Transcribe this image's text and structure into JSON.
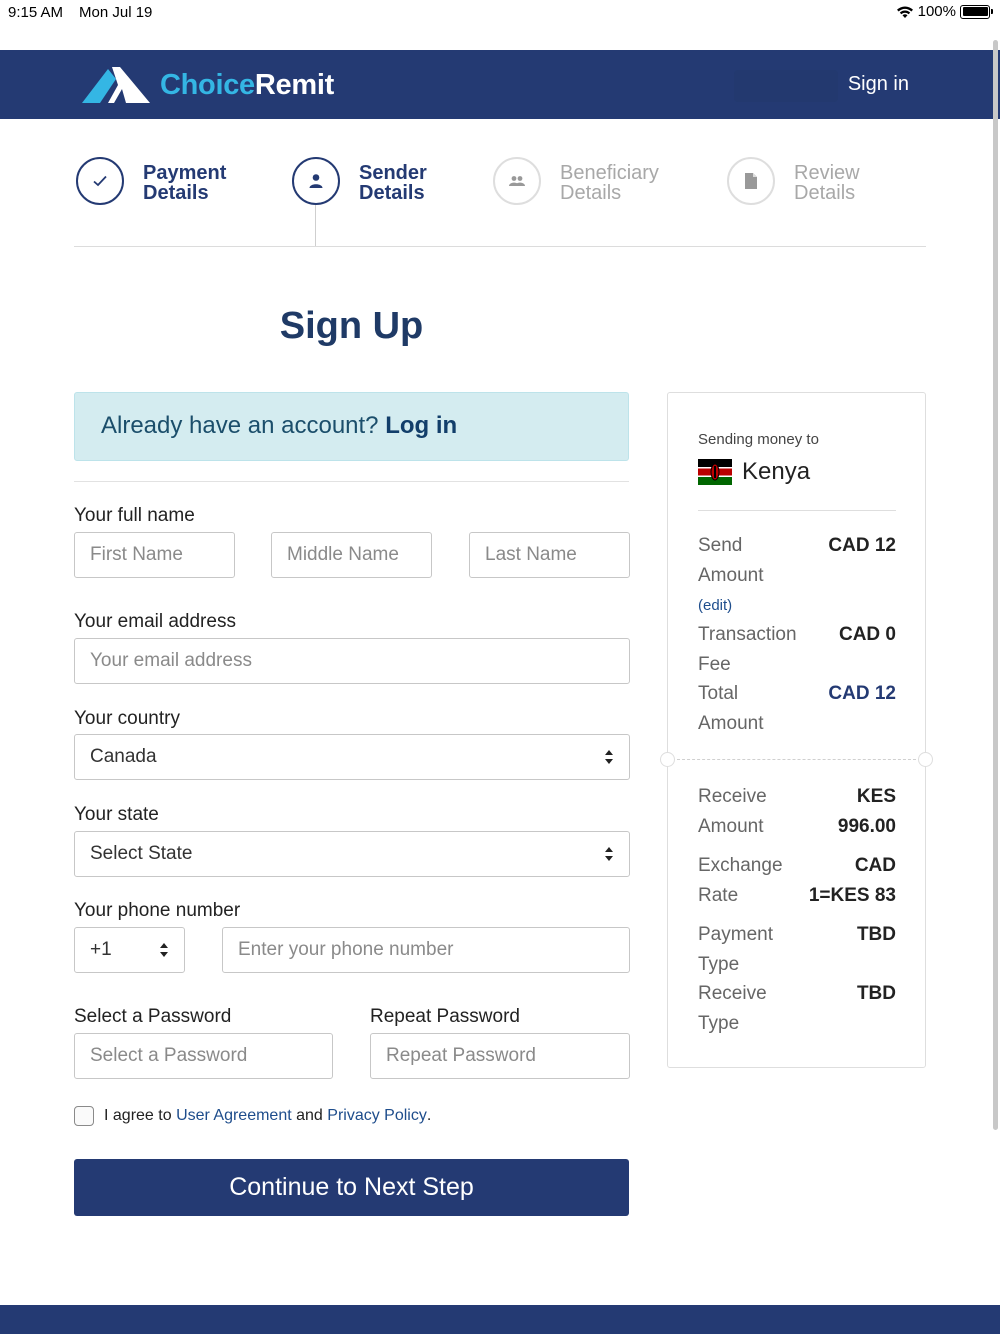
{
  "status_bar": {
    "time": "9:15 AM",
    "date": "Mon Jul 19",
    "battery": "100%"
  },
  "header": {
    "logo_choice": "Choice",
    "logo_remit": "Remit",
    "sign_in": "Sign in"
  },
  "steps": [
    {
      "line1": "Payment",
      "line2": "Details",
      "icon": "check-icon",
      "state": "completed"
    },
    {
      "line1": "Sender",
      "line2": "Details",
      "icon": "user-icon",
      "state": "current"
    },
    {
      "line1": "Beneficiary",
      "line2": "Details",
      "icon": "users-icon",
      "state": "upcoming"
    },
    {
      "line1": "Review",
      "line2": "Details",
      "icon": "document-icon",
      "state": "upcoming"
    }
  ],
  "page_title": "Sign Up",
  "login_prompt": {
    "text": "Already have an account?",
    "link": "Log in"
  },
  "form": {
    "full_name_label": "Your full name",
    "first_name_placeholder": "First Name",
    "middle_name_placeholder": "Middle Name",
    "last_name_placeholder": "Last Name",
    "email_label": "Your email address",
    "email_placeholder": "Your email address",
    "country_label": "Your country",
    "country_value": "Canada",
    "state_label": "Your state",
    "state_value": "Select State",
    "phone_label": "Your phone number",
    "phone_code": "+1",
    "phone_placeholder": "Enter your phone number",
    "password_label": "Select a Password",
    "password_placeholder": "Select a Password",
    "repeat_password_label": "Repeat Password",
    "repeat_password_placeholder": "Repeat Password",
    "agree_prefix": "I agree to",
    "agree_link1": "User Agreement",
    "agree_and": "and",
    "agree_link2": "Privacy Policy",
    "agree_suffix": ".",
    "continue_button": "Continue to Next Step"
  },
  "summary": {
    "caption": "Sending money to",
    "country": "Kenya",
    "send_amount_key": "Send Amount",
    "send_amount_val": "CAD 12",
    "edit": "(edit)",
    "fee_key": "Transaction Fee",
    "fee_val": "CAD 0",
    "total_key": "Total Amount",
    "total_val": "CAD 12",
    "receive_amount_key": "Receive Amount",
    "receive_amount_val": "KES 996.00",
    "exchange_key": "Exchange Rate",
    "exchange_val": "CAD 1=KES 83",
    "payment_type_key": "Payment Type",
    "payment_type_val": "TBD",
    "receive_type_key": "Receive Type",
    "receive_type_val": "TBD"
  },
  "colors": {
    "brand": "#243a73",
    "accent": "#34b6e4",
    "alert_bg": "#d4ecf0"
  }
}
